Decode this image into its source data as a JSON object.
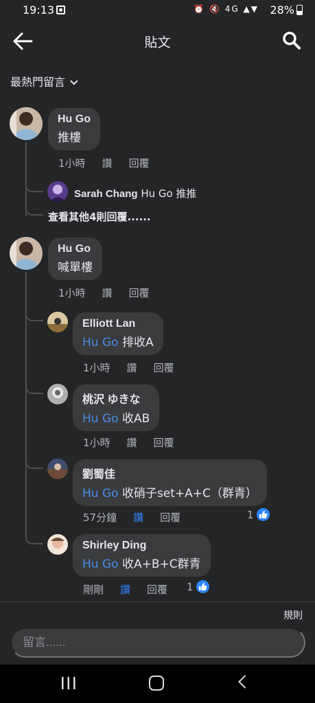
{
  "status": {
    "time": "19:13",
    "icons": "⏰ 🔇 4G ▲▼",
    "battery": "28%"
  },
  "header": {
    "title": "貼文"
  },
  "sort": {
    "label": "最熱門留言"
  },
  "comments": [
    {
      "name": "Hu Go",
      "text": "推樓",
      "time": "1小時",
      "like": "讚",
      "reply": "回覆",
      "reply_preview": {
        "name": "Sarah Chang",
        "text": "Hu Go 推推"
      },
      "more": "查看其他4則回覆......"
    },
    {
      "name": "Hu Go",
      "text": "喊單樓",
      "time": "1小時",
      "like": "讚",
      "reply": "回覆",
      "replies": [
        {
          "name": "Elliott Lan",
          "mention": "Hu Go",
          "text": "排收A",
          "time": "1小時",
          "like": "讚",
          "reply": "回覆"
        },
        {
          "name": "桃沢 ゆきな",
          "mention": "Hu Go",
          "text": "收AB",
          "time": "1小時",
          "like": "讚",
          "reply": "回覆"
        },
        {
          "name": "劉蜀佳",
          "mention": "Hu Go",
          "text": "收硝子set+A+C（群青）",
          "time": "57分鐘",
          "like": "讚",
          "reply": "回覆",
          "likes": "1"
        },
        {
          "name": "Shirley Ding",
          "mention": "Hu Go",
          "text": "收A+B+C群青",
          "time": "剛剛",
          "like": "讚",
          "reply": "回覆",
          "likes": "1"
        }
      ]
    }
  ],
  "footer": {
    "rules": "規則",
    "placeholder": "留言......"
  },
  "colors": {
    "background": "#242526",
    "bubble": "#3a3b3c",
    "accent": "#2d88ff",
    "mention": "#4b8ce6"
  }
}
